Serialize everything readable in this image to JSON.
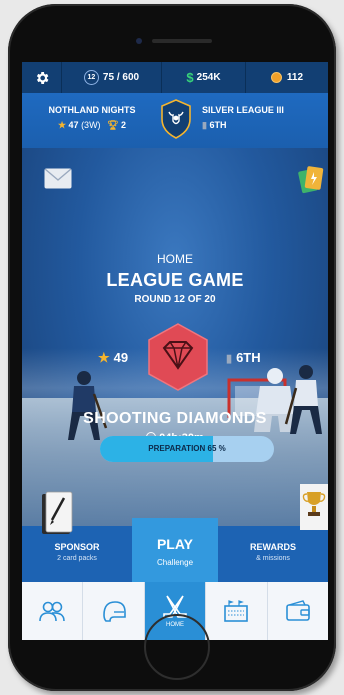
{
  "topbar": {
    "energy_level": "12",
    "energy": "75 / 600",
    "money": "254K",
    "coins": "112"
  },
  "league": {
    "team_name": "NOTHLAND NIGHTS",
    "team_stars": "47",
    "team_stars_suffix": "(3W)",
    "team_trophies": "2",
    "league_name": "SILVER LEAGUE III",
    "league_rank": "6TH"
  },
  "main": {
    "location": "HOME",
    "title": "LEAGUE GAME",
    "round": "ROUND 12 OF 20",
    "opponent_stars": "49",
    "opponent_rank": "6TH",
    "opponent_name": "SHOOTING DIAMONDS",
    "timer": "04h:30m",
    "preparation_label": "PREPARATION 65 %",
    "preparation_fraction": 0.65
  },
  "bottom": {
    "sponsor_title": "SPONSOR",
    "sponsor_sub": "2 card packs",
    "play_title": "PLAY",
    "play_sub": "Challenge",
    "rewards_title": "REWARDS",
    "rewards_sub": "& missions"
  },
  "nav": {
    "tabs": [
      {
        "icon": "team-icon"
      },
      {
        "icon": "helmet-icon"
      },
      {
        "icon": "hockey-sticks-icon",
        "label": "HOME"
      },
      {
        "icon": "arena-icon"
      },
      {
        "icon": "wallet-icon"
      }
    ]
  },
  "colors": {
    "accent": "#2a8fd6",
    "play": "#3399de",
    "gem": "#e04a55",
    "star": "#f6b52e",
    "money": "#38d37a",
    "coin": "#f0a02a"
  }
}
